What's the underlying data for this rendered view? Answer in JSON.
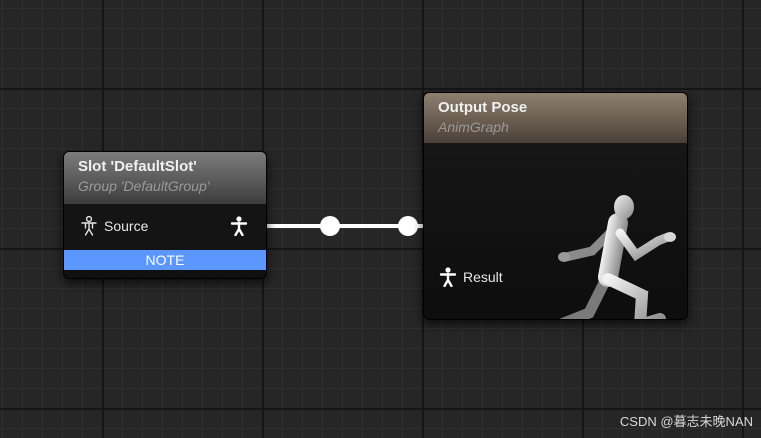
{
  "slot_node": {
    "title": "Slot 'DefaultSlot'",
    "subtitle": "Group 'DefaultGroup'",
    "input_pin_label": "Source",
    "note_label": "NOTE"
  },
  "output_node": {
    "title": "Output Pose",
    "subtitle": "AnimGraph",
    "input_pin_label": "Result"
  },
  "icons": {
    "pose_pin": "mannequin-icon",
    "preview": "running-mannequin-icon"
  },
  "colors": {
    "note_bar": "#5b97ff",
    "wire": "#ffffff"
  },
  "watermark": "CSDN @暮志未晚NAN"
}
